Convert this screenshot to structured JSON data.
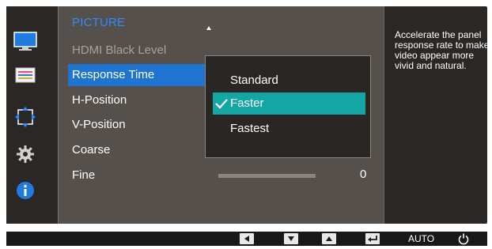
{
  "menu": {
    "title": "PICTURE",
    "items": [
      {
        "label": "HDMI Black Level",
        "state": "disabled"
      },
      {
        "label": "Response Time",
        "state": "selected"
      },
      {
        "label": "H-Position",
        "state": "normal"
      },
      {
        "label": "V-Position",
        "state": "normal"
      },
      {
        "label": "Coarse",
        "state": "normal"
      },
      {
        "label": "Fine",
        "state": "normal"
      }
    ]
  },
  "submenu": {
    "options": [
      {
        "label": "Standard",
        "checked": false
      },
      {
        "label": "Faster",
        "checked": true
      },
      {
        "label": "Fastest",
        "checked": false
      }
    ]
  },
  "fine": {
    "value": "0"
  },
  "help_text": "Accelerate the panel response rate to make video appear more vivid and natural.",
  "sidebar_icons": [
    "picture-icon",
    "onscreen-display-icon",
    "position-icon",
    "settings-gear-icon",
    "information-icon"
  ],
  "bottom_bar": {
    "keys": [
      "left-arrow-icon",
      "down-arrow-icon",
      "up-arrow-icon",
      "enter-icon"
    ],
    "auto_label": "AUTO",
    "power_icon": "power-icon"
  },
  "colors": {
    "accent_blue": "#2f8cff",
    "selection_blue": "#1f73d1",
    "selection_teal": "#14a5a5",
    "panel_bg": "#55504c",
    "dark_bg": "#2b2725"
  }
}
